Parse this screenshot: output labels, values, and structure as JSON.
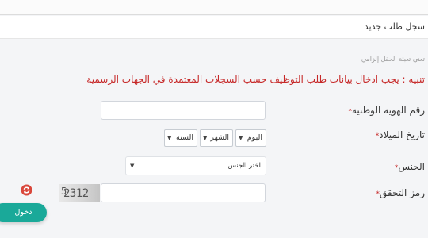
{
  "page": {
    "title": "سجل طلب جديد",
    "hint": "تعني تعبئة الحقل إلزامي",
    "warning": "تنبيه : يجب ادخال بيانات طلب التوظيف حسب السجلات المعتمدة في الجهات الرسمية",
    "required_marker": "*"
  },
  "form": {
    "national_id": {
      "label": "رقم الهوية الوطنية",
      "value": ""
    },
    "birth_date": {
      "label": "تاريخ الميلاد",
      "day": "اليوم",
      "month": "الشهر",
      "year": "السنة"
    },
    "gender": {
      "label": "الجنس",
      "selected": "اختر الجنس"
    },
    "captcha": {
      "label": "رمز التحقق",
      "image_text": "2312",
      "image_text_tail": "5",
      "value": ""
    }
  },
  "actions": {
    "login": "دخول"
  },
  "colors": {
    "accent": "#1aa999",
    "required": "#c62828",
    "refresh": "#d9473b"
  },
  "icons": {
    "refresh": "refresh-icon",
    "caret": "chevron-down-icon"
  }
}
